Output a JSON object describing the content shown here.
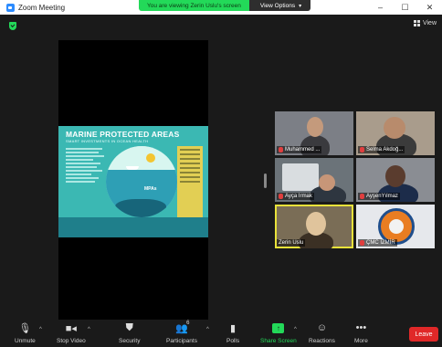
{
  "window": {
    "title": "Zoom Meeting",
    "minimize": "–",
    "maximize": "☐",
    "close": "✕"
  },
  "share_banner": {
    "text": "You are viewing Zerin Uslu's screen",
    "view_options": "View Options"
  },
  "top_right": {
    "view_label": "View"
  },
  "shared_content": {
    "title": "MARINE PROTECTED AREAS",
    "subtitle": "SMART INVESTMENTS IN OCEAN HEALTH",
    "mpa_label": "MPAs"
  },
  "participants": [
    {
      "name": "Muhammed ...",
      "muted": true
    },
    {
      "name": "Selma Akdoğ...",
      "muted": true
    },
    {
      "name": "Ayça Irmak",
      "muted": true
    },
    {
      "name": "AyşenYılmaz",
      "muted": true
    },
    {
      "name": "Zerin Uslu",
      "muted": false,
      "active_speaker": true
    },
    {
      "name": "ÇMC İZMİR",
      "muted": true
    }
  ],
  "toolbar": {
    "unmute": "Unmute",
    "stop_video": "Stop Video",
    "security": "Security",
    "participants": "Participants",
    "participant_count": "6",
    "polls": "Polls",
    "share_screen": "Share Screen",
    "reactions": "Reactions",
    "more": "More",
    "leave": "Leave"
  },
  "colors": {
    "share_green": "#23d959",
    "leave_red": "#e02828",
    "active_speaker": "#e8e23a",
    "background": "#1a1a1a"
  }
}
